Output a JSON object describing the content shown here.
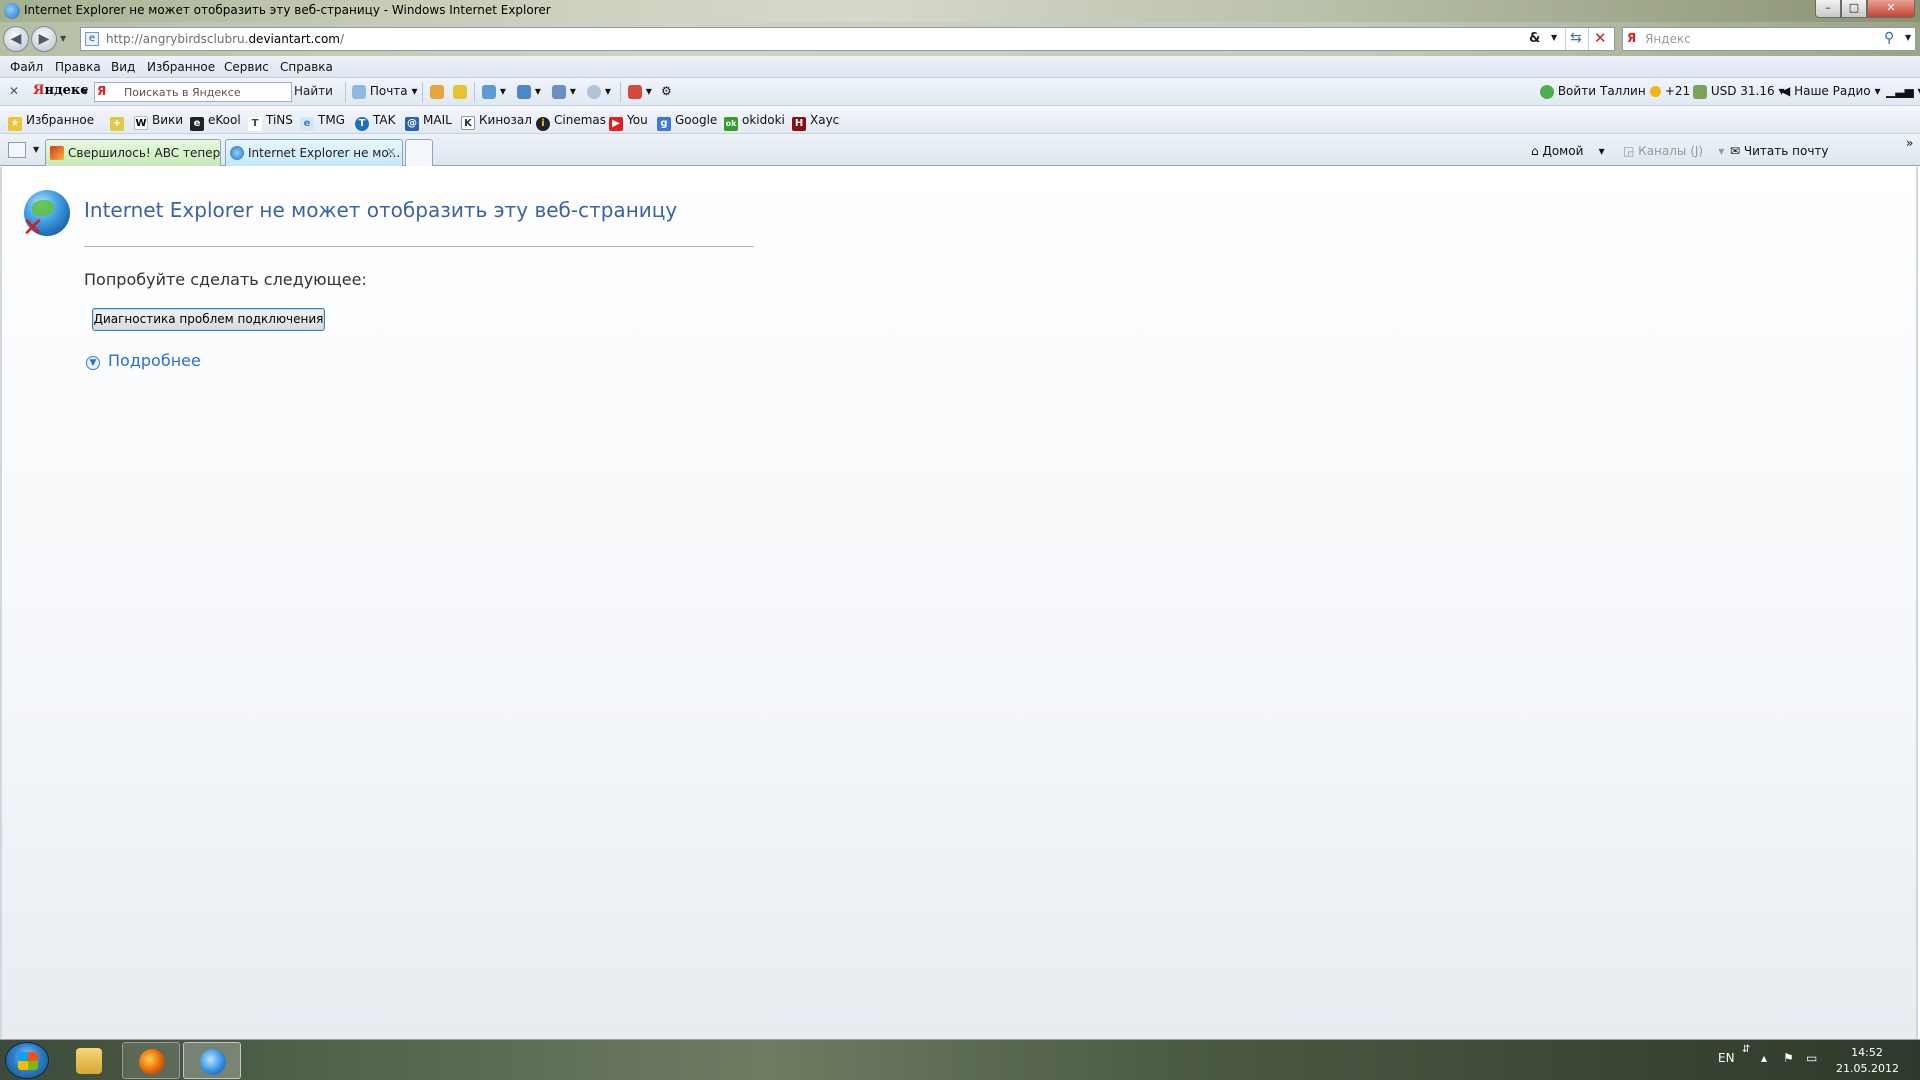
{
  "window": {
    "title": "Internet Explorer не может отобразить эту веб-страницу - Windows Internet Explorer",
    "min_label": "–",
    "max_label": "□",
    "close_label": "✕"
  },
  "address": {
    "url_prefix": "http://angrybirdsclubru.",
    "url_domain": "deviantart.com",
    "url_suffix": "/",
    "amp": "&",
    "search_brand": "Я",
    "search_placeholder": "Яндекс"
  },
  "menu": [
    "Файл",
    "Правка",
    "Вид",
    "Избранное",
    "Сервис",
    "Справка"
  ],
  "yandex_bar": {
    "logo_first": "Я",
    "logo_rest": "ндекс",
    "input_brand": "Я",
    "input_placeholder": "Поискать в Яндексе",
    "find_label": "Найти",
    "mail_label": "Почта",
    "login_label": "Войти",
    "city": "Таллин",
    "weather": "+21",
    "currency": "USD 31.16",
    "radio": "Наше Радио"
  },
  "links_bar": {
    "favorites_label": "Избранное",
    "links": [
      {
        "label": "Вики",
        "icon": "W",
        "color": "#ffffff"
      },
      {
        "label": "eKool",
        "icon": "e",
        "color": "#222222"
      },
      {
        "label": "TiNS",
        "icon": "T",
        "color": "#ffffff"
      },
      {
        "label": "TMG",
        "icon": "e",
        "color": "#2c7fd0"
      },
      {
        "label": "TAK",
        "icon": "T",
        "color": "#1d6fc0"
      },
      {
        "label": "MAIL",
        "icon": "@",
        "color": "#2a64a8"
      },
      {
        "label": "Кинозал",
        "icon": "K",
        "color": "#ffffff"
      },
      {
        "label": "Cinemas",
        "icon": "i",
        "color": "#222222"
      },
      {
        "label": "You",
        "icon": "▶",
        "color": "#e02020"
      },
      {
        "label": "Google",
        "icon": "g",
        "color": "#3a7bd5"
      },
      {
        "label": "okidoki",
        "icon": "ok",
        "color": "#3a9a2a"
      },
      {
        "label": "Хаус",
        "icon": "H",
        "color": "#8a0f12"
      }
    ]
  },
  "tabs": [
    {
      "label": "Свершилось! ABC теперь...",
      "active": false
    },
    {
      "label": "Internet Explorer не мо...",
      "active": true
    }
  ],
  "command_bar": {
    "home_label": "Домой",
    "feeds_label": "Каналы (J)",
    "mail_label": "Читать почту"
  },
  "content": {
    "title": "Internet Explorer не может отобразить эту веб-страницу",
    "try_label": "Попробуйте сделать следующее:",
    "diagnose_button": "Диагностика проблем подключения",
    "more_label": "Подробнее"
  },
  "taskbar": {
    "lang": "EN",
    "time": "14:52",
    "date": "21.05.2012"
  },
  "colors": {
    "title_link": "#3a63a8",
    "more_link": "#2a6fcf"
  }
}
